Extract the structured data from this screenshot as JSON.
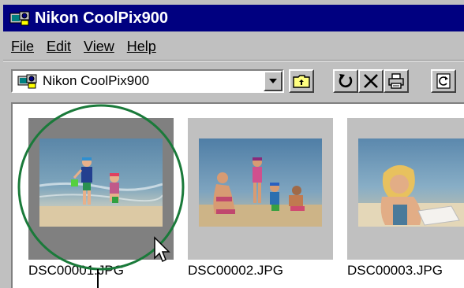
{
  "window": {
    "title": "Nikon CoolPix900"
  },
  "menu": {
    "items": [
      {
        "label": "File"
      },
      {
        "label": "Edit"
      },
      {
        "label": "View"
      },
      {
        "label": "Help"
      }
    ]
  },
  "toolbar": {
    "location": "Nikon CoolPix900",
    "buttons": [
      {
        "name": "up-folder-icon"
      },
      {
        "name": "undo-icon"
      },
      {
        "name": "delete-icon"
      },
      {
        "name": "print-icon"
      },
      {
        "name": "refresh-icon"
      }
    ]
  },
  "files": [
    {
      "name": "DSC00001.JPG",
      "selected": true
    },
    {
      "name": "DSC00002.JPG",
      "selected": false
    },
    {
      "name": "DSC00003.JPG",
      "selected": false
    }
  ],
  "colors": {
    "titlebar": "#000080",
    "face": "#c0c0c0",
    "selection": "#808080",
    "annotation": "#1a7a3a"
  }
}
